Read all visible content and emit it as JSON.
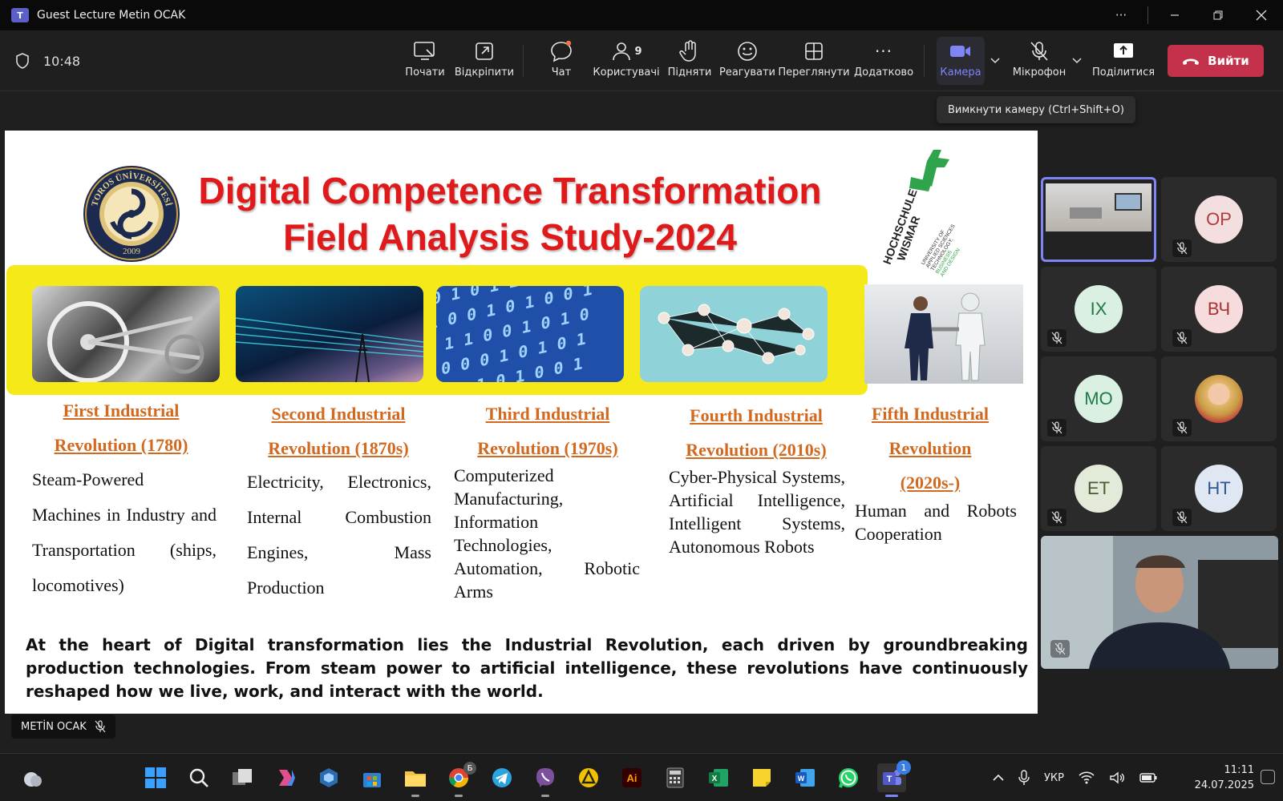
{
  "window": {
    "title": "Guest Lecture Metin OCAK"
  },
  "meeting": {
    "time": "10:48"
  },
  "toolbar": {
    "items": [
      {
        "label": "Почати"
      },
      {
        "label": "Відкріпити"
      },
      {
        "label": "Чат"
      },
      {
        "label": "Користувачі",
        "badge": "9"
      },
      {
        "label": "Підняти"
      },
      {
        "label": "Реагувати"
      },
      {
        "label": "Переглянути"
      },
      {
        "label": "Додатково"
      },
      {
        "label": "Камера"
      },
      {
        "label": "Мікрофон"
      },
      {
        "label": "Поділитися"
      }
    ],
    "leave_label": "Вийти",
    "tooltip": "Вимкнути камеру (Ctrl+Shift+O)",
    "accent": "#7f85f5",
    "leave_color": "#c4314b"
  },
  "slide": {
    "title_line1": "Digital Competence Transformation",
    "title_line2": "Field Analysis Study-2024",
    "title_color": "#e0191b",
    "seal": {
      "top_text": "TOROS ÜNİVERSİTESİ",
      "year": "2009"
    },
    "partner_logo": {
      "name_line1": "HOCHSCHULE",
      "name_line2": "WISMAR",
      "sub": [
        "UNIVERSITY OF",
        "APPLIED SCIENCES",
        "TECHNOLOGY,",
        "BUSINESS",
        "AND DESIGN"
      ]
    },
    "revolutions": [
      {
        "h1": "First Industrial",
        "h2": "Revolution (1780)",
        "body": "Steam-Powered Machines in Industry and Transportation (ships, locomotives)"
      },
      {
        "h1": "Second Industrial",
        "h2": "Revolution (1870s)",
        "body": "Electricity, Electronics, Internal Combustion Engines, Mass Production"
      },
      {
        "h1": "Third Industrial",
        "h2": "Revolution (1970s)",
        "body": "Computerized Manufacturing, Information Technologies, Automation, Robotic Arms"
      },
      {
        "h1": "Fourth Industrial",
        "h2": "Revolution (2010s)",
        "body": "Cyber-Physical Systems, Artificial Intelligence, Intelligent Systems, Autonomous Robots"
      },
      {
        "h1": "Fifth Industrial",
        "h2": "Revolution",
        "h3": "(2020s-)",
        "body": "Human and Robots Cooperation"
      }
    ],
    "summary": "At the heart of Digital transformation lies the Industrial Revolution, each driven by groundbreaking production technologies. From steam power to artificial intelligence, these revolutions have continuously reshaped how we live, work, and interact with the world."
  },
  "presenter": {
    "name": "METİN OCAK"
  },
  "participants": [
    {
      "initials": "",
      "type": "video-room"
    },
    {
      "initials": "OP",
      "bg": "#f3dfe0",
      "fg": "#b33a3a"
    },
    {
      "initials": "IX",
      "bg": "#d9f0e3",
      "fg": "#1f7a4a"
    },
    {
      "initials": "ВЧ",
      "bg": "#f6dcdc",
      "fg": "#a83232"
    },
    {
      "initials": "MO",
      "bg": "#d9f0e3",
      "fg": "#1f7a4a"
    },
    {
      "initials": "",
      "type": "photo"
    },
    {
      "initials": "ET",
      "bg": "#e4ead9",
      "fg": "#4b5a33"
    },
    {
      "initials": "HT",
      "bg": "#dfe7f3",
      "fg": "#2f5690"
    }
  ],
  "taskbar": {
    "language": "УКР",
    "time": "11:11",
    "date": "24.07.2025",
    "chrome_badge": "Б",
    "teams_badge": "1"
  }
}
